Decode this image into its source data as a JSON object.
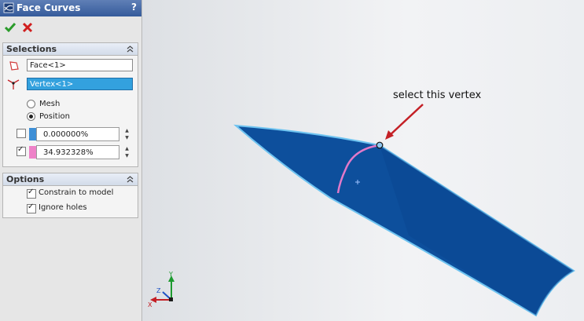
{
  "title": "Face Curves",
  "help_label": "?",
  "icons": {
    "app": "face-curves-icon",
    "ok": "check-icon",
    "cancel": "x-icon",
    "face": "face-icon",
    "vertex": "vertex-icon",
    "collapse": "double-chevron-up-icon"
  },
  "selections": {
    "header": "Selections",
    "face_value": "Face<1>",
    "vertex_value": "Vertex<1>",
    "mesh_label": "Mesh",
    "position_label": "Position",
    "position_mode": "Position",
    "direction1_value": "0.000000%",
    "direction1_checked": false,
    "direction2_value": "34.932328%",
    "direction2_checked": true
  },
  "options": {
    "header": "Options",
    "constrain_label": "Constrain to model",
    "constrain_checked": true,
    "ignore_holes_label": "Ignore holes",
    "ignore_holes_checked": true
  },
  "viewport": {
    "annotation": "select this vertex",
    "triad_labels": {
      "x": "X",
      "y": "Y",
      "z": "Z"
    }
  },
  "colors": {
    "face_fill": "#0d4f9c",
    "face_edge": "#6ec3f0",
    "curve": "#e279c9",
    "arrow": "#c42026",
    "swatch1": "#3e8fd6",
    "swatch2": "#ee82c8"
  }
}
